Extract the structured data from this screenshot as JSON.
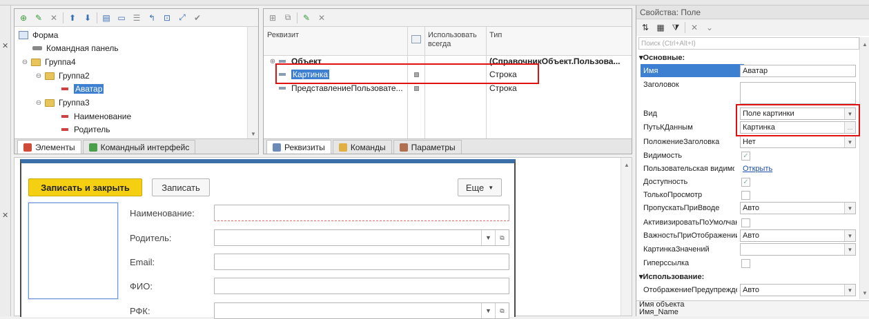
{
  "elements_tree": {
    "items": [
      {
        "label": "Форма"
      },
      {
        "label": "Командная панель"
      },
      {
        "label": "Группа4"
      },
      {
        "label": "Группа2"
      },
      {
        "label": "Аватар"
      },
      {
        "label": "Группа3"
      },
      {
        "label": "Наименование"
      },
      {
        "label": "Родитель"
      }
    ],
    "tabs": [
      "Элементы",
      "Командный интерфейс"
    ]
  },
  "attributes": {
    "headers": {
      "name": "Реквизит",
      "use_always": "Использовать всегда",
      "type": "Тип"
    },
    "rows": [
      {
        "name": "Объект",
        "type": "(СправочникОбъект.Пользова..."
      },
      {
        "name": "Картинка",
        "type": "Строка"
      },
      {
        "name": "ПредставлениеПользовате...",
        "type": "Строка"
      }
    ],
    "tabs": [
      "Реквизиты",
      "Команды",
      "Параметры"
    ]
  },
  "form_preview": {
    "save_close_label": "Записать и закрыть",
    "save_label": "Записать",
    "more_label": "Еще",
    "fields": [
      {
        "label": "Наименование:"
      },
      {
        "label": "Родитель:"
      },
      {
        "label": "Email:"
      },
      {
        "label": "ФИО:"
      },
      {
        "label": "РФК:"
      }
    ]
  },
  "properties": {
    "title": "Свойства: Поле",
    "search_placeholder": "Поиск (Ctrl+Alt+I)",
    "section_main": "Основные:",
    "section_usage": "Использование:",
    "rows": [
      {
        "label": "Имя",
        "value": "Аватар"
      },
      {
        "label": "Заголовок",
        "value": ""
      },
      {
        "label": "Вид",
        "value": "Поле картинки"
      },
      {
        "label": "ПутьКДанным",
        "value": "Картинка"
      },
      {
        "label": "ПоложениеЗаголовка",
        "value": "Нет"
      },
      {
        "label": "Видимость",
        "value": ""
      },
      {
        "label": "Пользовательская видимость",
        "value": "Открыть"
      },
      {
        "label": "Доступность",
        "value": ""
      },
      {
        "label": "ТолькоПросмотр",
        "value": ""
      },
      {
        "label": "ПропускатьПриВводе",
        "value": "Авто"
      },
      {
        "label": "АктивизироватьПоУмолчанию",
        "value": ""
      },
      {
        "label": "ВажностьПриОтображении",
        "value": "Авто"
      },
      {
        "label": "КартинкаЗначений",
        "value": ""
      },
      {
        "label": "Гиперссылка",
        "value": ""
      },
      {
        "label": "ОтображениеПредупреждения",
        "value": "Авто"
      }
    ],
    "footer_line1": "Имя объекта",
    "footer_line2": "Имя_Name"
  },
  "colors": {
    "highlight_red": "#e01010",
    "selection_blue": "#3d7fd0",
    "primary_button": "#f5d012"
  }
}
